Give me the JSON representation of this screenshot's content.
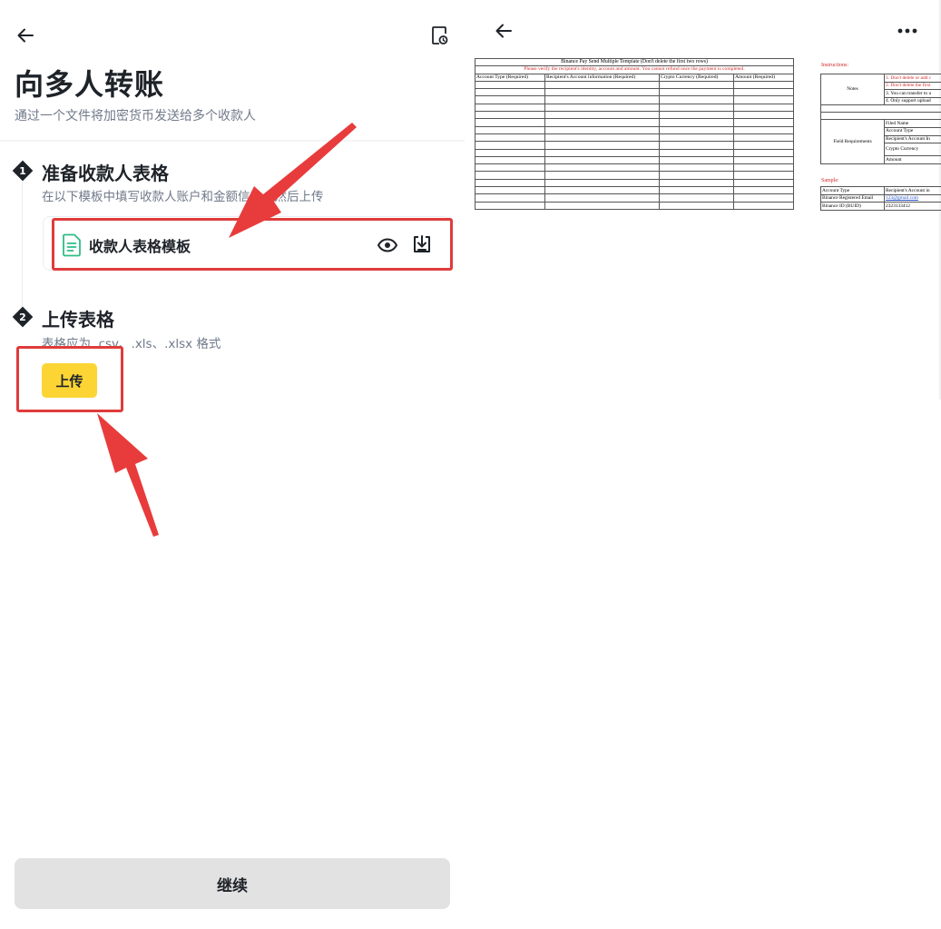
{
  "left": {
    "title": "向多人转账",
    "subtitle": "通过一个文件将加密货币发送给多个收款人",
    "steps": [
      {
        "number": "1",
        "title": "准备收款人表格",
        "description": "在以下模板中填写收款人账户和金额信息，然后上传"
      },
      {
        "number": "2",
        "title": "上传表格",
        "description": "表格应为 .csv、.xls、.xlsx 格式"
      }
    ],
    "template": {
      "name": "收款人表格模板"
    },
    "upload_label": "上传",
    "continue_label": "继续"
  },
  "colors": {
    "accent_yellow": "#fcd535",
    "annotation_red": "#e03b3b",
    "doc_icon_green": "#2ebd85",
    "continue_bg": "#e2e2e2"
  },
  "icons": [
    "back-arrow-icon",
    "history-icon",
    "document-icon",
    "eye-icon",
    "download-icon",
    "more-icon"
  ],
  "preview": {
    "template_title": "Binance Pay Send Multiple Template (Don't delete the first two rows)",
    "warning": "Please verify the recipient's identity, account and amount. You cannot refund once the payment is completed.",
    "columns": [
      "Account Type (Required)",
      "Recipient's Account information (Required)",
      "Crypto Currency (Required)",
      "Amount (Required)"
    ],
    "instructions_label": "Instructions:",
    "notes_label": "Notes",
    "notes": [
      "1. Don't delete or add c",
      "2. Don't delete the first",
      "3. You can transfer to u",
      "4. Only support upload"
    ],
    "field_requirements_label": "Field Requirements",
    "fields": [
      "Filed Name",
      "Account Type",
      "Recipient's Account In",
      "Crypto Currency",
      "Amount"
    ],
    "sample_label": "Sample:",
    "sample_header": [
      "Account Type",
      "Recipient's Account in"
    ],
    "sample_rows": [
      [
        "Binance Registered Email",
        "123@gmail.com"
      ],
      [
        "Binance ID (BUID)",
        "2323133412"
      ]
    ]
  }
}
